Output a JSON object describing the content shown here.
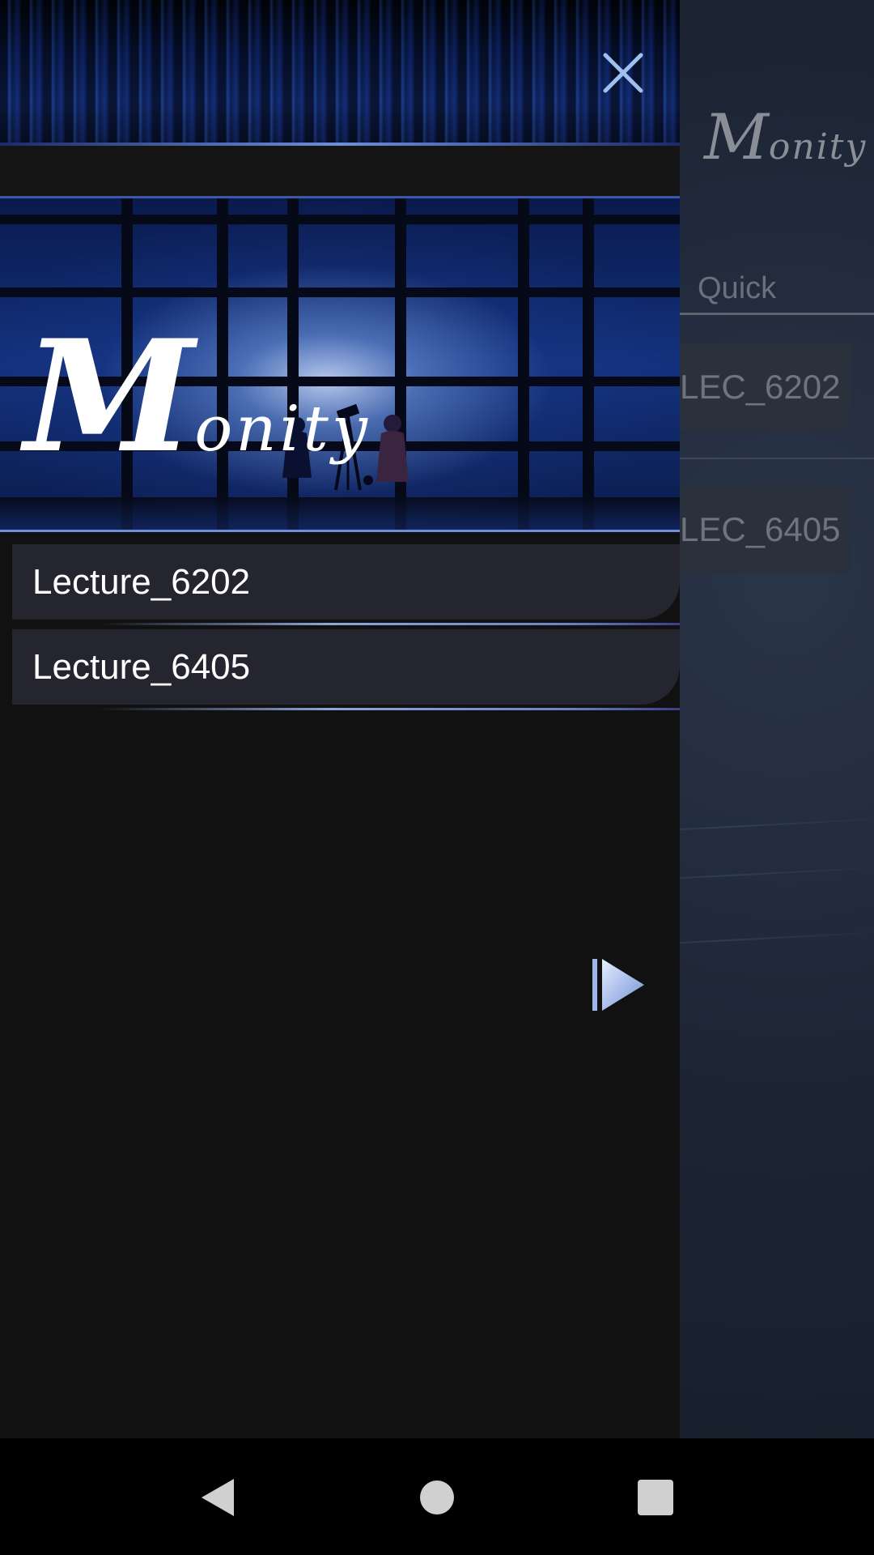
{
  "main": {
    "logo_big": "M",
    "logo_small": "onity",
    "tab_label": "Quick",
    "cards": [
      {
        "label": "LEC_6202"
      },
      {
        "label": "LEC_6405"
      }
    ]
  },
  "drawer": {
    "close_icon": "close-icon",
    "hero": {
      "logo_big": "M",
      "logo_small": "onity"
    },
    "lectures": [
      {
        "label": "Lecture_6202"
      },
      {
        "label": "Lecture_6405"
      }
    ],
    "play_icon": "play-icon"
  },
  "navbar": {
    "back_icon": "back-triangle-icon",
    "home_icon": "home-circle-icon",
    "recents_icon": "recents-square-icon"
  },
  "colors": {
    "drawer_bg": "#111112",
    "item_bg": "#252530",
    "accent": "#8fa6d8"
  }
}
